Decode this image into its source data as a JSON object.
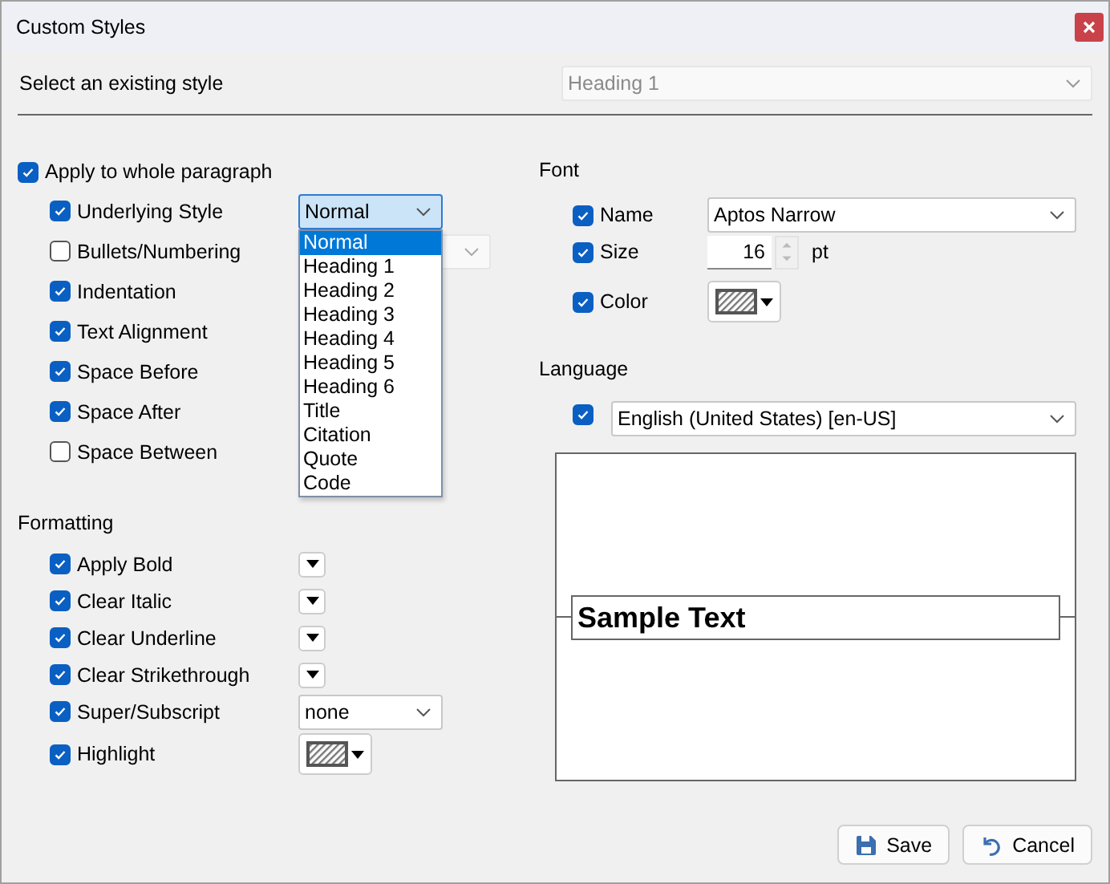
{
  "window": {
    "title": "Custom Styles"
  },
  "existing_style": {
    "label": "Select an existing style",
    "value": "Heading 1",
    "disabled": true
  },
  "paragraph": {
    "label": "Apply to whole paragraph",
    "checked": true,
    "options": [
      {
        "label": "Underlying Style",
        "checked": true,
        "kind": "combo",
        "value": "Normal",
        "open": true
      },
      {
        "label": "Bullets/Numbering",
        "checked": false,
        "kind": "combo",
        "disabled": true
      },
      {
        "label": "Indentation",
        "checked": true,
        "kind": "plain"
      },
      {
        "label": "Text Alignment",
        "checked": true,
        "kind": "plain"
      },
      {
        "label": "Space Before",
        "checked": true,
        "kind": "plain"
      },
      {
        "label": "Space After",
        "checked": true,
        "kind": "plain"
      },
      {
        "label": "Space Between",
        "checked": false,
        "kind": "plain"
      }
    ]
  },
  "underlying_list": [
    {
      "label": "Normal",
      "selected": true
    },
    {
      "label": "Heading 1",
      "selected": false
    },
    {
      "label": "Heading 2",
      "selected": false
    },
    {
      "label": "Heading 3",
      "selected": false
    },
    {
      "label": "Heading 4",
      "selected": false
    },
    {
      "label": "Heading 5",
      "selected": false
    },
    {
      "label": "Heading 6",
      "selected": false
    },
    {
      "label": "Title",
      "selected": false
    },
    {
      "label": "Citation",
      "selected": false
    },
    {
      "label": "Quote",
      "selected": false
    },
    {
      "label": "Code",
      "selected": false
    }
  ],
  "formatting": {
    "title": "Formatting",
    "options": [
      {
        "label": "Apply Bold",
        "checked": true,
        "kind": "toggle"
      },
      {
        "label": "Clear Italic",
        "checked": true,
        "kind": "toggle"
      },
      {
        "label": "Clear Underline",
        "checked": true,
        "kind": "toggle"
      },
      {
        "label": "Clear Strikethrough",
        "checked": true,
        "kind": "toggle"
      },
      {
        "label": "Super/Subscript",
        "checked": true,
        "kind": "combo",
        "value": "none"
      },
      {
        "label": "Highlight",
        "checked": true,
        "kind": "color"
      }
    ]
  },
  "font": {
    "title": "Font",
    "name": {
      "label": "Name",
      "checked": true,
      "value": "Aptos Narrow"
    },
    "size": {
      "label": "Size",
      "checked": true,
      "value": "16",
      "unit": "pt"
    },
    "color": {
      "label": "Color",
      "checked": true
    }
  },
  "language": {
    "title": "Language",
    "checked": true,
    "value": "English (United States) [en-US]"
  },
  "preview": {
    "text": "Sample Text"
  },
  "buttons": [
    {
      "label": "Save",
      "kind": "save"
    },
    {
      "label": "Cancel",
      "kind": "cancel"
    }
  ]
}
